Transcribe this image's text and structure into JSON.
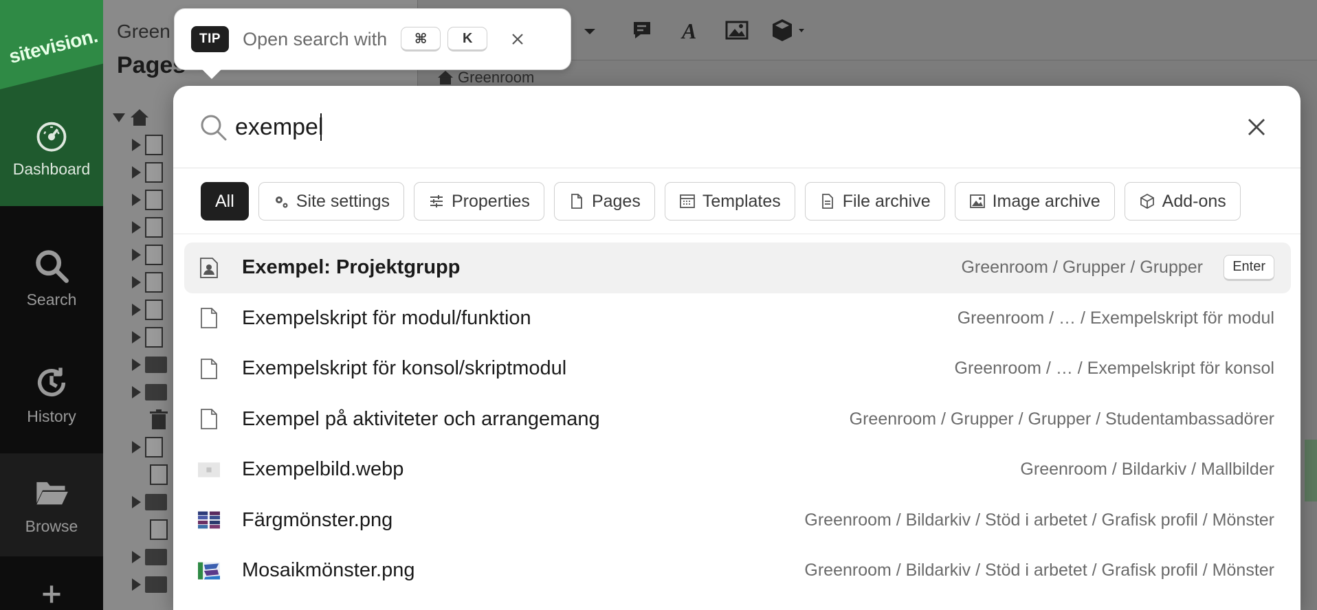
{
  "app": {
    "logo_text": "sitevision.",
    "nav": [
      {
        "label": "Dashboard",
        "icon": "dashboard-icon"
      },
      {
        "label": "Search",
        "icon": "search-icon"
      },
      {
        "label": "History",
        "icon": "history-icon"
      },
      {
        "label": "Browse",
        "icon": "folder-open-icon"
      }
    ]
  },
  "workspace": {
    "site_name": "Green",
    "panel_title": "Pages",
    "breadcrumb": "Greenroom"
  },
  "tip": {
    "badge": "TIP",
    "text": "Open search with",
    "keys": [
      "⌘",
      "K"
    ]
  },
  "search": {
    "query": "exempel",
    "filters": [
      {
        "label": "All",
        "icon": "",
        "active": true
      },
      {
        "label": "Site settings",
        "icon": "gears-icon"
      },
      {
        "label": "Properties",
        "icon": "sliders-icon"
      },
      {
        "label": "Pages",
        "icon": "page-icon"
      },
      {
        "label": "Templates",
        "icon": "template-icon"
      },
      {
        "label": "File archive",
        "icon": "file-icon"
      },
      {
        "label": "Image archive",
        "icon": "image-icon"
      },
      {
        "label": "Add-ons",
        "icon": "cube-icon"
      }
    ],
    "enter_label": "Enter",
    "results": [
      {
        "title": "Exempel: Projektgrupp",
        "path": "Greenroom / Grupper / Grupper",
        "icon": "group-page-icon",
        "selected": true
      },
      {
        "title": "Exempelskript för modul/funktion",
        "path": "Greenroom / … / Exempelskript för modul",
        "icon": "page-icon"
      },
      {
        "title": "Exempelskript för konsol/skriptmodul",
        "path": "Greenroom / … / Exempelskript för konsol",
        "icon": "page-icon"
      },
      {
        "title": "Exempel på aktiviteter och arrangemang",
        "path": "Greenroom / Grupper / Grupper / Studentambassadörer",
        "icon": "page-icon"
      },
      {
        "title": "Exempelbild.webp",
        "path": "Greenroom / Bildarkiv / Mallbilder",
        "icon": "image-thumbnail-icon"
      },
      {
        "title": "Färgmönster.png",
        "path": "Greenroom / Bildarkiv / Stöd i arbetet / Grafisk profil / Mönster",
        "icon": "color-pattern-thumbnail-icon"
      },
      {
        "title": "Mosaikmönster.png",
        "path": "Greenroom / Bildarkiv / Stöd i arbetet / Grafisk profil / Mönster",
        "icon": "mosaic-pattern-thumbnail-icon"
      }
    ]
  },
  "colors": {
    "brand_green": "#2f8a45",
    "chip_active": "#1f1f1f",
    "selected_row": "#f1f1f1"
  }
}
